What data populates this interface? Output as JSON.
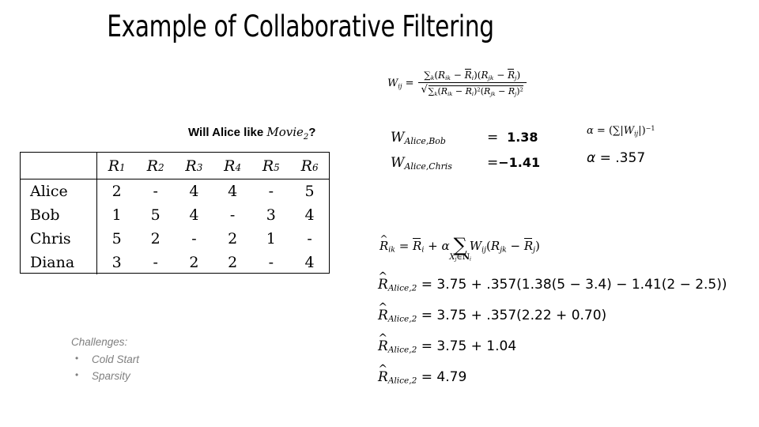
{
  "slide": {
    "title": "Example of Collaborative Filtering"
  },
  "table_section": {
    "caption_prefix": "Will Alice like ",
    "caption_math_base": "Movie",
    "caption_math_sub": "2",
    "caption_suffix": "?",
    "columns": [
      "",
      "R1",
      "R2",
      "R3",
      "R4",
      "R5",
      "R6"
    ],
    "column_bases": [
      "",
      "R",
      "R",
      "R",
      "R",
      "R",
      "R"
    ],
    "column_subs": [
      "",
      "1",
      "2",
      "3",
      "4",
      "5",
      "6"
    ],
    "rows": [
      {
        "name": "Alice",
        "values": [
          "2",
          "-",
          "4",
          "4",
          "-",
          "5"
        ]
      },
      {
        "name": "Bob",
        "values": [
          "1",
          "5",
          "4",
          "-",
          "3",
          "4"
        ]
      },
      {
        "name": "Chris",
        "values": [
          "5",
          "2",
          "-",
          "2",
          "1",
          "-"
        ]
      },
      {
        "name": "Diana",
        "values": [
          "3",
          "-",
          "2",
          "2",
          "-",
          "4"
        ]
      }
    ]
  },
  "challenges": {
    "heading": "Challenges:",
    "bullet_glyph": "•",
    "items": [
      "Cold Start",
      "Sparsity"
    ],
    "color": "#7f7f7f"
  },
  "formulas": {
    "similarity": {
      "lhs_base": "W",
      "lhs_sub": "ij",
      "equals": "=",
      "numerator_plain": "∑k(Rik − R̄i)(Rjk − R̄j)",
      "denominator_plain": "√(∑k(Rik − R̄i)²(Rjk − R̄j)²)",
      "sum_symbol": "∑",
      "sum_sub": "k",
      "minus": "−"
    },
    "alpha_definition": {
      "lhs": "α",
      "equals": "=",
      "rhs_plain": "(∑ |Wij|)⁻¹",
      "sum_symbol": "∑",
      "abs_open": "|",
      "abs_close": "|",
      "w_base": "W",
      "w_sub": "ij",
      "exponent": "−1"
    },
    "prediction": {
      "lhs_base": "R",
      "lhs_sub": "ik",
      "equals": "=",
      "rhs_plain": "R̄i + α ∑(Xj ∈ Ni) Wij(Rjk − R̄j)",
      "sum_symbol": "∑",
      "sum_sub_x": "X",
      "sum_sub_xsub": "j",
      "sum_sub_in": "∈",
      "sum_sub_n": "N",
      "sum_sub_nsub": "i",
      "alpha": "α",
      "plus": "+",
      "minus": "−"
    }
  },
  "weights": [
    {
      "label_base": "W",
      "label_sub": "Alice,Bob",
      "equals": "=",
      "value": "1.38"
    },
    {
      "label_base": "W",
      "label_sub": "Alice,Chris",
      "equals": "=",
      "value": "−1.41"
    }
  ],
  "alpha_value": {
    "symbol": "α",
    "equals": "=",
    "value": ".357"
  },
  "calculations": [
    {
      "lhs_base": "R",
      "lhs_sub": "Alice,2",
      "equals": "=",
      "rhs": "3.75 + .357(1.38(5 − 3.4)  − 1.41(2 − 2.5))"
    },
    {
      "lhs_base": "R",
      "lhs_sub": "Alice,2",
      "equals": "=",
      "rhs": "3.75 + .357(2.22 + 0.70)"
    },
    {
      "lhs_base": "R",
      "lhs_sub": "Alice,2",
      "equals": "=",
      "rhs": "3.75 + 1.04"
    },
    {
      "lhs_base": "R",
      "lhs_sub": "Alice,2",
      "equals": "=",
      "rhs": "4.79"
    }
  ]
}
